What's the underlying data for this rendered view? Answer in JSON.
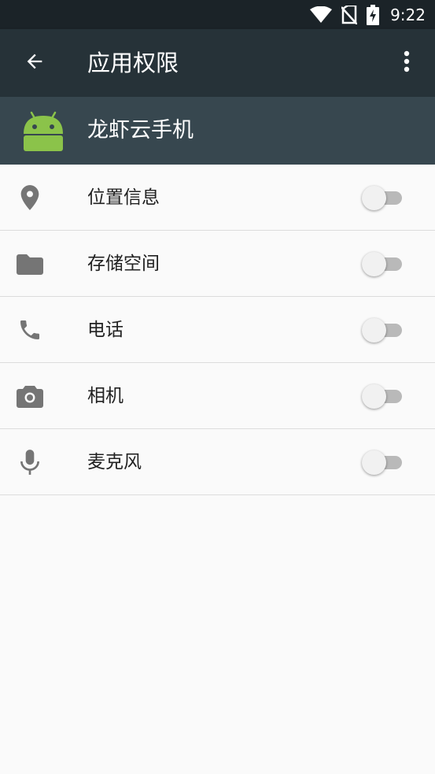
{
  "status_bar": {
    "time": "9:22",
    "icons": [
      "wifi-icon",
      "no-sim-icon",
      "battery-charging-icon"
    ]
  },
  "app_bar": {
    "title": "应用权限",
    "back_icon": "arrow-back-icon",
    "menu_icon": "more-vert-icon"
  },
  "app_header": {
    "icon": "android-icon",
    "name": "龙虾云手机"
  },
  "permissions": [
    {
      "icon": "location-pin-icon",
      "label": "位置信息",
      "enabled": false
    },
    {
      "icon": "folder-icon",
      "label": "存储空间",
      "enabled": false
    },
    {
      "icon": "phone-icon",
      "label": "电话",
      "enabled": false
    },
    {
      "icon": "camera-icon",
      "label": "相机",
      "enabled": false
    },
    {
      "icon": "microphone-icon",
      "label": "麦克风",
      "enabled": false
    }
  ],
  "colors": {
    "status_bar": "#1b2328",
    "app_bar": "#263238",
    "app_header": "#37474f",
    "background": "#fafafa",
    "icon_gray": "#757575",
    "android_green": "#8bc34a"
  }
}
